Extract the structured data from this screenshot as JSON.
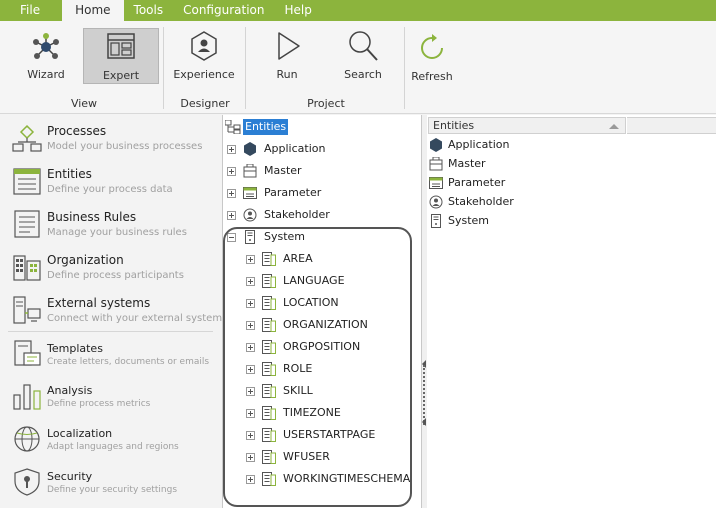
{
  "menu": {
    "items": [
      "File",
      "Home",
      "Tools",
      "Configuration",
      "Help"
    ],
    "active": "Home"
  },
  "ribbon": {
    "buttons": {
      "wizard": "Wizard",
      "expert": "Expert",
      "experience": "Experience",
      "run": "Run",
      "search": "Search",
      "refresh": "Refresh"
    },
    "groups": {
      "view": "View",
      "designer": "Designer",
      "project": "Project"
    },
    "accent_color": "#8cb43d"
  },
  "nav": {
    "items": [
      {
        "title": "Processes",
        "desc": "Model your business processes",
        "icon": "processes-icon"
      },
      {
        "title": "Entities",
        "desc": "Define your process data",
        "icon": "entities-icon"
      },
      {
        "title": "Business Rules",
        "desc": "Manage your business rules",
        "icon": "business-rules-icon"
      },
      {
        "title": "Organization",
        "desc": "Define process participants",
        "icon": "organization-icon"
      },
      {
        "title": "External systems",
        "desc": "Connect with your external systems",
        "icon": "external-systems-icon"
      },
      {
        "title": "Templates",
        "desc": "Create letters, documents or emails",
        "icon": "templates-icon"
      },
      {
        "title": "Analysis",
        "desc": "Define process metrics",
        "icon": "analysis-icon"
      },
      {
        "title": "Localization",
        "desc": "Adapt languages and regions",
        "icon": "localization-icon"
      },
      {
        "title": "Security",
        "desc": "Define your security settings",
        "icon": "security-icon"
      }
    ]
  },
  "tree": {
    "root": "Entities",
    "categories": [
      "Application",
      "Master",
      "Parameter",
      "Stakeholder",
      "System"
    ],
    "system_children": [
      "AREA",
      "LANGUAGE",
      "LOCATION",
      "ORGANIZATION",
      "ORGPOSITION",
      "ROLE",
      "SKILL",
      "TIMEZONE",
      "USERSTARTPAGE",
      "WFUSER",
      "WORKINGTIMESCHEMA"
    ]
  },
  "list": {
    "header": "Entities",
    "items": [
      "Application",
      "Master",
      "Parameter",
      "Stakeholder",
      "System"
    ]
  }
}
